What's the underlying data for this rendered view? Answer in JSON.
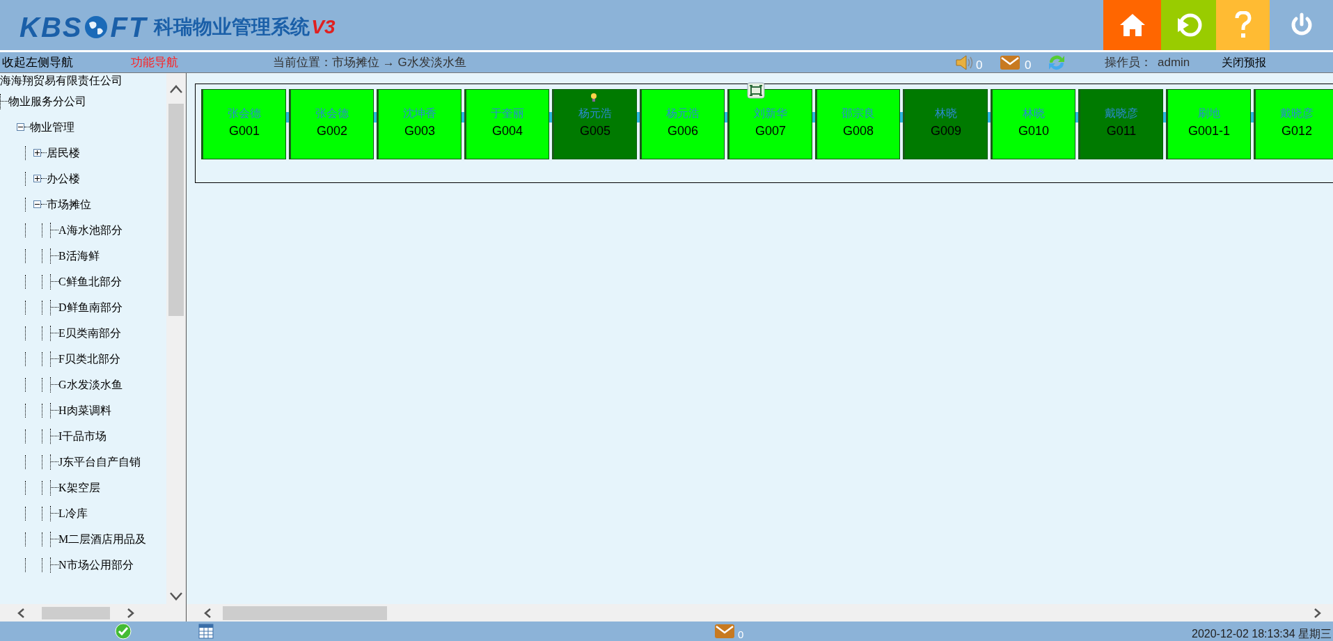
{
  "header": {
    "logo_left": "KBS",
    "logo_right": "FT",
    "product": "科瑞物业管理系统",
    "version": "V3"
  },
  "subbar": {
    "collapse": "收起左侧导航",
    "function_nav": "功能导航",
    "location": "当前位置：市场摊位 → G水发淡水鱼",
    "sound_count": "0",
    "mail_count": "0",
    "operator_label": "操作员：",
    "operator": "admin",
    "close_forecast": "关闭预报"
  },
  "tree": [
    {
      "label": "海海翔贸易有限责任公司",
      "children": [
        {
          "label": "物业服务分公司",
          "children": [
            {
              "label": "物业管理",
              "expanded": true,
              "children": [
                {
                  "label": "居民楼",
                  "expanded": false
                },
                {
                  "label": "办公楼",
                  "expanded": false
                },
                {
                  "label": "市场摊位",
                  "expanded": true,
                  "children": [
                    {
                      "label": "A海水池部分"
                    },
                    {
                      "label": "B活海鲜"
                    },
                    {
                      "label": "C鲜鱼北部分"
                    },
                    {
                      "label": "D鲜鱼南部分"
                    },
                    {
                      "label": "E贝类南部分"
                    },
                    {
                      "label": "F贝类北部分"
                    },
                    {
                      "label": "G水发淡水鱼"
                    },
                    {
                      "label": "H肉菜调料"
                    },
                    {
                      "label": "I干品市场"
                    },
                    {
                      "label": "J东平台自产自销"
                    },
                    {
                      "label": "K架空层"
                    },
                    {
                      "label": "L冷库"
                    },
                    {
                      "label": "M二层酒店用品及"
                    },
                    {
                      "label": "N市场公用部分"
                    }
                  ]
                }
              ]
            }
          ]
        }
      ]
    }
  ],
  "stalls": [
    {
      "name": "张会德",
      "code": "G001",
      "occupied": false,
      "bulb": false,
      "screen_icon": false
    },
    {
      "name": "张会德",
      "code": "G002",
      "occupied": false,
      "bulb": false,
      "screen_icon": false
    },
    {
      "name": "沈坤香",
      "code": "G003",
      "occupied": false,
      "bulb": false,
      "screen_icon": false
    },
    {
      "name": "于奎丽",
      "code": "G004",
      "occupied": false,
      "bulb": false,
      "screen_icon": false
    },
    {
      "name": "杨元浩",
      "code": "G005",
      "occupied": true,
      "bulb": true,
      "screen_icon": false
    },
    {
      "name": "杨元浩",
      "code": "G006",
      "occupied": false,
      "bulb": false,
      "screen_icon": false
    },
    {
      "name": "刘新华",
      "code": "G007",
      "occupied": false,
      "bulb": false,
      "screen_icon": true
    },
    {
      "name": "邵宗良",
      "code": "G008",
      "occupied": false,
      "bulb": false,
      "screen_icon": false
    },
    {
      "name": "林晓",
      "code": "G009",
      "occupied": true,
      "bulb": false,
      "screen_icon": false
    },
    {
      "name": "林晓",
      "code": "G010",
      "occupied": false,
      "bulb": false,
      "screen_icon": false
    },
    {
      "name": "戴晓彦",
      "code": "G011",
      "occupied": true,
      "bulb": false,
      "screen_icon": false
    },
    {
      "name": "刷地",
      "code": "G001-1",
      "occupied": false,
      "bulb": false,
      "screen_icon": false
    },
    {
      "name": "戴晓彦",
      "code": "G012",
      "occupied": false,
      "bulb": false,
      "screen_icon": false
    }
  ],
  "status_bar": {
    "mail_count": "0",
    "datetime": "2020-12-02 18:13:34 星期三"
  }
}
